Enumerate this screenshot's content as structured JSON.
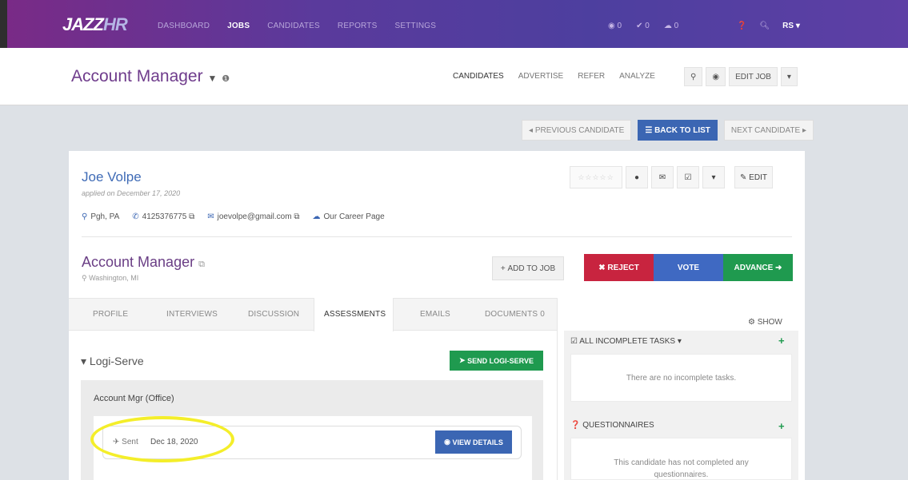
{
  "brand": {
    "logo_main": "JAZZ",
    "logo_suffix": "HR"
  },
  "topnav": {
    "links": [
      "DASHBOARD",
      "JOBS",
      "CANDIDATES",
      "REPORTS",
      "SETTINGS"
    ],
    "active": "JOBS",
    "views_count": "0",
    "checks_count": "0",
    "messages_count": "0",
    "user_initials": "RS"
  },
  "job": {
    "title": "Account Manager",
    "tabs": [
      "CANDIDATES",
      "ADVERTISE",
      "REFER",
      "ANALYZE"
    ],
    "edit_label": "EDIT JOB"
  },
  "candidate_nav": {
    "previous": "PREVIOUS CANDIDATE",
    "back": "BACK TO LIST",
    "next": "NEXT CANDIDATE"
  },
  "candidate": {
    "name": "Joe Volpe",
    "applied": "applied on December 17, 2020",
    "location": "Pgh, PA",
    "phone": "4125376775",
    "email": "joevolpe@gmail.com",
    "source": "Our Career Page",
    "edit_label": "EDIT",
    "rating": 0
  },
  "position": {
    "title": "Account Manager",
    "location": "Washington, MI",
    "add_to_job": "ADD TO JOB",
    "reject": "REJECT",
    "vote": "VOTE",
    "advance": "ADVANCE"
  },
  "tabs": {
    "profile": "PROFILE",
    "interviews": "INTERVIEWS",
    "discussion": "DISCUSSION",
    "assessments": "ASSESSMENTS",
    "emails": "EMAILS",
    "documents": "DOCUMENTS 0"
  },
  "assessment": {
    "section": "Logi-Serve",
    "send_label": "SEND LOGI-SERVE",
    "name": "Account Mgr (Office)",
    "status": "Sent",
    "date": "Dec 18, 2020",
    "view_details": "VIEW DETAILS"
  },
  "right_panel": {
    "show_label": "SHOW",
    "tasks_title": "ALL INCOMPLETE TASKS",
    "tasks_empty": "There are no incomplete tasks.",
    "questionnaires_title": "QUESTIONNAIRES",
    "questionnaires_empty": "This candidate has not completed any questionnaires."
  }
}
